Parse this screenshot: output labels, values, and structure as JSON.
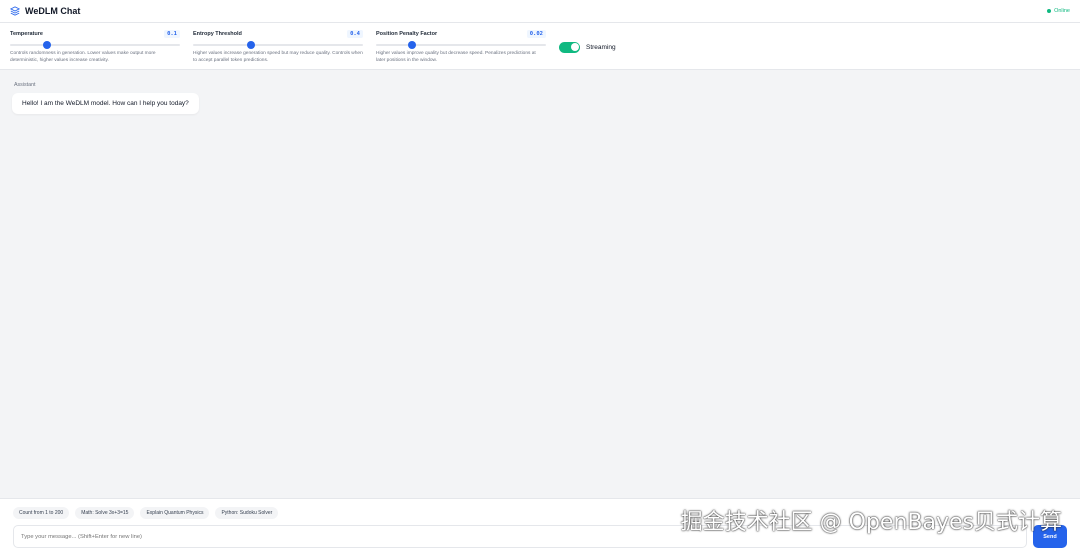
{
  "header": {
    "title": "WeDLM Chat",
    "status": "Online",
    "status_color": "#10b981",
    "logo_icon": "layers-icon"
  },
  "controls": [
    {
      "label": "Temperature",
      "value": "0.1",
      "slider_percent": 22,
      "description": "Controls randomness in generation. Lower values make output more deterministic, higher values increase creativity."
    },
    {
      "label": "Entropy Threshold",
      "value": "0.4",
      "slider_percent": 34,
      "description": "Higher values increase generation speed but may reduce quality. Controls when to accept parallel token predictions."
    },
    {
      "label": "Position Penalty Factor",
      "value": "0.02",
      "slider_percent": 21,
      "description": "Higher values improve quality but decrease speed. Penalizes predictions at later positions in the window."
    }
  ],
  "streaming": {
    "label": "Streaming",
    "enabled": true
  },
  "messages": [
    {
      "role": "Assistant",
      "text": "Hello! I am the WeDLM model. How can I help you today?"
    }
  ],
  "suggestions": [
    "Count from 1 to 200",
    "Math: Solve 3x+3=15",
    "Explain Quantum Physics",
    "Python: Sudoku Solver"
  ],
  "composer": {
    "placeholder": "Type your message... (Shift+Enter for new line)",
    "value": "",
    "send_label": "Send"
  },
  "watermark": "掘金技术社区 @ OpenBayes贝式计算",
  "accent": "#2563eb"
}
